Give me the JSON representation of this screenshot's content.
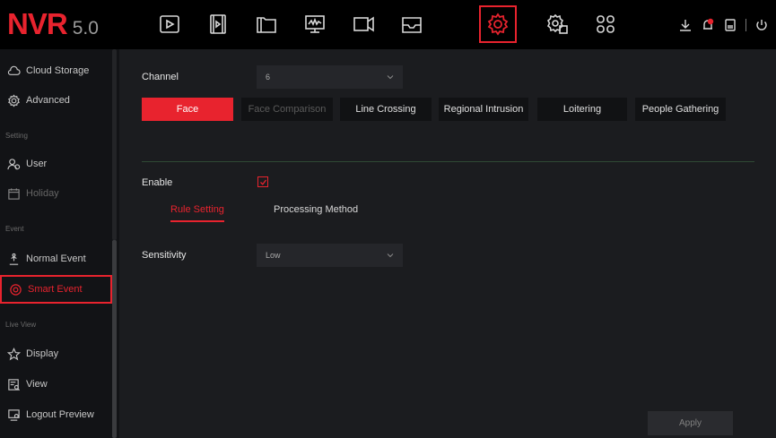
{
  "topbar": {
    "logo_main": "NVR",
    "logo_version": "5.0",
    "nav_icons": [
      "playback-icon",
      "video-file-icon",
      "folder-icon",
      "monitor-icon",
      "camera-icon",
      "storage-icon",
      "settings-icon",
      "system-settings-icon",
      "apps-grid-icon"
    ],
    "status_icons": [
      "download-icon",
      "alarm-icon",
      "disk-icon",
      "power-icon"
    ],
    "accent_color": "#e8232e"
  },
  "sidebar": {
    "items": [
      {
        "label": "Cloud Storage",
        "icon": "cloud-icon"
      },
      {
        "label": "Advanced",
        "icon": "advanced-gear-icon"
      },
      {
        "label": "User",
        "icon": "user-icon"
      },
      {
        "label": "Holiday",
        "icon": "calendar-icon"
      },
      {
        "label": "Normal Event",
        "icon": "event-alert-icon"
      },
      {
        "label": "Smart Event",
        "icon": "smart-event-icon"
      },
      {
        "label": "Display",
        "icon": "star-icon"
      },
      {
        "label": "View",
        "icon": "view-icon"
      },
      {
        "label": "Logout Preview",
        "icon": "logout-preview-icon"
      }
    ],
    "sections": [
      "Setting",
      "Event",
      "Live View"
    ]
  },
  "content": {
    "channel_label": "Channel",
    "channel_value": "6",
    "tabs": [
      {
        "label": "Face"
      },
      {
        "label": "Face Comparison"
      },
      {
        "label": "Line Crossing"
      },
      {
        "label": "Regional Intrusion"
      },
      {
        "label": "Loitering"
      },
      {
        "label": "People Gathering"
      }
    ],
    "enable_label": "Enable",
    "subtabs": [
      {
        "label": "Rule Setting"
      },
      {
        "label": "Processing Method"
      }
    ],
    "sensitivity_label": "Sensitivity",
    "sensitivity_value": "Low",
    "apply_label": "Apply"
  }
}
